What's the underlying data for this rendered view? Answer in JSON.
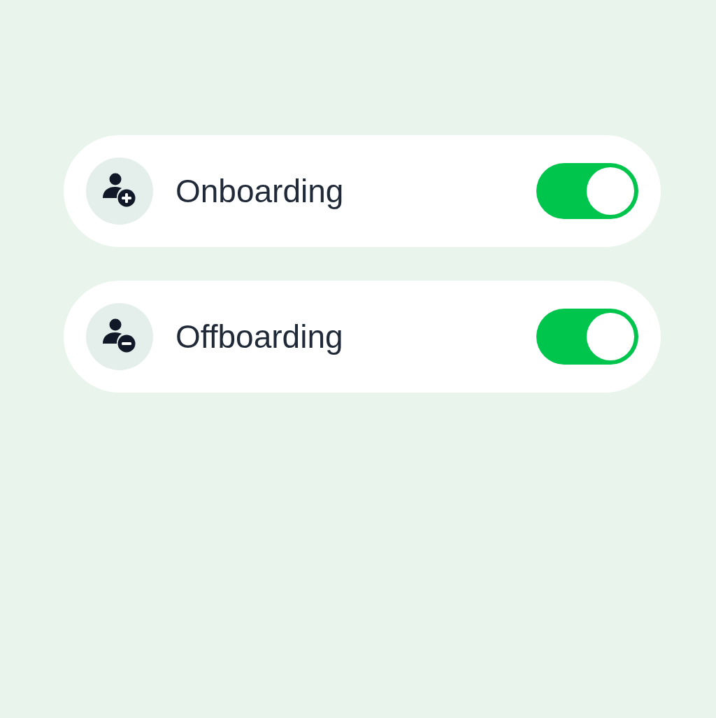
{
  "settings": [
    {
      "kind": "add",
      "label": "Onboarding",
      "on": true
    },
    {
      "kind": "remove",
      "label": "Offboarding",
      "on": true
    }
  ]
}
